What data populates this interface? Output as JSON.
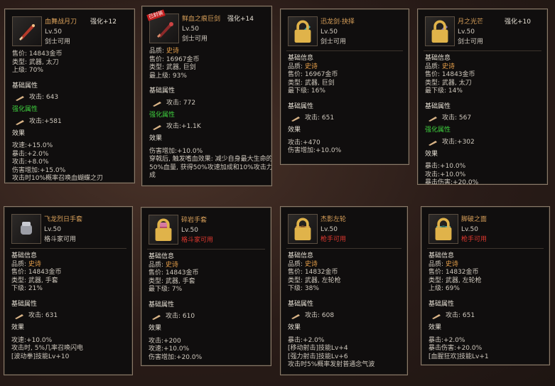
{
  "cards": [
    {
      "name": "血舞战月刀",
      "enhance": "强化+12",
      "level": "Lv.50",
      "usable": "剑士可用",
      "info": [
        "售价: 14843金币",
        "类型: 武器, 太刀",
        "上级: 70%"
      ],
      "base_title": "基础属性",
      "base_attack": "攻击: 643",
      "enh_title": "强化属性",
      "enh_attack": "攻击:+581",
      "effect_title": "效果",
      "effects": [
        "攻速:+15.0%",
        "暴击:+2.0%",
        "攻击:+8.0%",
        "伤害增加:+15.0%",
        "攻击时10%概率召唤血蝴蝶之刃"
      ]
    },
    {
      "name": "鲜血之痕巨剑",
      "enhance": "强化+14",
      "badge": "已封装",
      "level": "Lv.50",
      "usable": "剑士可用",
      "quality_label": "品质:",
      "quality_value": "史诗",
      "info": [
        "售价: 16967金币",
        "类型: 武器, 巨剑",
        "最上级: 93%"
      ],
      "base_title": "基础属性",
      "base_attack": "攻击: 772",
      "enh_title": "强化属性",
      "enh_attack": "攻击:+1.1K",
      "effect_title": "效果",
      "effects": [
        "伤害增加:+10.0%",
        "穿戟后, 触发嗜血效果: 减少自身最大生命的",
        "50%血量, 获得50%攻速加成和10%攻击力加",
        "成"
      ]
    },
    {
      "name": "迅龙剑·抉择",
      "level": "Lv.50",
      "usable": "剑士可用",
      "info_title": "基础信息",
      "quality_label": "品质:",
      "quality_value": "史诗",
      "info": [
        "售价: 16967金币",
        "类型: 武器, 巨剑",
        "最下级: 16%"
      ],
      "base_title": "基础属性",
      "base_attack": "攻击: 651",
      "effect_title": "效果",
      "effects": [
        "攻击:+470",
        "伤害增加:+10.0%"
      ]
    },
    {
      "name": "月之光芒",
      "enhance": "强化+10",
      "level": "Lv.50",
      "usable": "剑士可用",
      "info_title": "基础信息",
      "quality_label": "品质:",
      "quality_value": "史诗",
      "info": [
        "售价: 14843金币",
        "类型: 武器, 太刀",
        "最下级: 14%"
      ],
      "base_title": "基础属性",
      "base_attack": "攻击: 567",
      "enh_title": "强化属性",
      "enh_attack": "攻击:+302",
      "effect_title": "效果",
      "effects": [
        "暴击:+10.0%",
        "攻击:+10.0%",
        "暴击伤害:+20.0%"
      ]
    },
    {
      "name": "飞龙烈日手套",
      "level": "Lv.50",
      "usable": "格斗家可用",
      "info_title": "基础信息",
      "quality_label": "品质:",
      "quality_value": "史诗",
      "info": [
        "售价: 14843金币",
        "类型: 武器, 手套",
        "下级: 21%"
      ],
      "base_title": "基础属性",
      "base_attack": "攻击: 631",
      "effect_title": "效果",
      "effects": [
        "攻速:+10.0%",
        "攻击时, 5%几率召唤闪电",
        "[波动拳]技能Lv+10"
      ]
    },
    {
      "name": "碎岩手套",
      "level": "Lv.50",
      "usable": "格斗家可用",
      "usable_red": true,
      "info_title": "基础信息",
      "quality_label": "品质:",
      "quality_value": "史诗",
      "info": [
        "售价: 14843金币",
        "类型: 武器, 手套",
        "最下级: 7%"
      ],
      "base_title": "基础属性",
      "base_attack": "攻击: 610",
      "effect_title": "效果",
      "effects": [
        "攻击:+200",
        "攻速:+10.0%",
        "伤害增加:+20.0%"
      ]
    },
    {
      "name": "杰影左轮",
      "level": "Lv.50",
      "usable": "枪手可用",
      "usable_red": true,
      "info_title": "基础信息",
      "quality_label": "品质:",
      "quality_value": "史诗",
      "info": [
        "售价: 14832金币",
        "类型: 武器, 左轮枪",
        "下级: 38%"
      ],
      "base_title": "基础属性",
      "base_attack": "攻击: 608",
      "effect_title": "效果",
      "effects": [
        "暴击:+2.0%",
        "[移动射击]技能Lv+4",
        "[强力射击]技能Lv+6",
        "攻击时5%概率发射普通念气波"
      ]
    },
    {
      "name": "脚破之面",
      "level": "Lv.50",
      "usable": "枪手可用",
      "usable_red": true,
      "info_title": "基础信息",
      "quality_label": "品质:",
      "quality_value": "史诗",
      "info": [
        "售价: 14832金币",
        "类型: 武器, 左轮枪",
        "上级: 69%"
      ],
      "base_title": "基础属性",
      "base_attack": "攻击: 651",
      "effect_title": "效果",
      "effects": [
        "暴击:+2.0%",
        "暴击伤害:+20.0%",
        "[血腥狂欢]技能Lv+1"
      ]
    }
  ]
}
